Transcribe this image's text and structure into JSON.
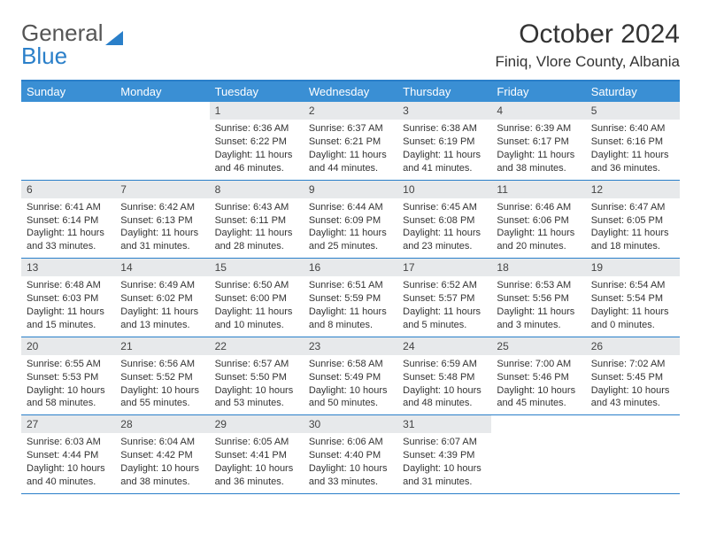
{
  "logo": {
    "part1": "General",
    "part2": "Blue"
  },
  "title": "October 2024",
  "location": "Finiq, Vlore County, Albania",
  "days_of_week": [
    "Sunday",
    "Monday",
    "Tuesday",
    "Wednesday",
    "Thursday",
    "Friday",
    "Saturday"
  ],
  "weeks": [
    [
      null,
      null,
      {
        "n": "1",
        "sr": "Sunrise: 6:36 AM",
        "ss": "Sunset: 6:22 PM",
        "d1": "Daylight: 11 hours",
        "d2": "and 46 minutes."
      },
      {
        "n": "2",
        "sr": "Sunrise: 6:37 AM",
        "ss": "Sunset: 6:21 PM",
        "d1": "Daylight: 11 hours",
        "d2": "and 44 minutes."
      },
      {
        "n": "3",
        "sr": "Sunrise: 6:38 AM",
        "ss": "Sunset: 6:19 PM",
        "d1": "Daylight: 11 hours",
        "d2": "and 41 minutes."
      },
      {
        "n": "4",
        "sr": "Sunrise: 6:39 AM",
        "ss": "Sunset: 6:17 PM",
        "d1": "Daylight: 11 hours",
        "d2": "and 38 minutes."
      },
      {
        "n": "5",
        "sr": "Sunrise: 6:40 AM",
        "ss": "Sunset: 6:16 PM",
        "d1": "Daylight: 11 hours",
        "d2": "and 36 minutes."
      }
    ],
    [
      {
        "n": "6",
        "sr": "Sunrise: 6:41 AM",
        "ss": "Sunset: 6:14 PM",
        "d1": "Daylight: 11 hours",
        "d2": "and 33 minutes."
      },
      {
        "n": "7",
        "sr": "Sunrise: 6:42 AM",
        "ss": "Sunset: 6:13 PM",
        "d1": "Daylight: 11 hours",
        "d2": "and 31 minutes."
      },
      {
        "n": "8",
        "sr": "Sunrise: 6:43 AM",
        "ss": "Sunset: 6:11 PM",
        "d1": "Daylight: 11 hours",
        "d2": "and 28 minutes."
      },
      {
        "n": "9",
        "sr": "Sunrise: 6:44 AM",
        "ss": "Sunset: 6:09 PM",
        "d1": "Daylight: 11 hours",
        "d2": "and 25 minutes."
      },
      {
        "n": "10",
        "sr": "Sunrise: 6:45 AM",
        "ss": "Sunset: 6:08 PM",
        "d1": "Daylight: 11 hours",
        "d2": "and 23 minutes."
      },
      {
        "n": "11",
        "sr": "Sunrise: 6:46 AM",
        "ss": "Sunset: 6:06 PM",
        "d1": "Daylight: 11 hours",
        "d2": "and 20 minutes."
      },
      {
        "n": "12",
        "sr": "Sunrise: 6:47 AM",
        "ss": "Sunset: 6:05 PM",
        "d1": "Daylight: 11 hours",
        "d2": "and 18 minutes."
      }
    ],
    [
      {
        "n": "13",
        "sr": "Sunrise: 6:48 AM",
        "ss": "Sunset: 6:03 PM",
        "d1": "Daylight: 11 hours",
        "d2": "and 15 minutes."
      },
      {
        "n": "14",
        "sr": "Sunrise: 6:49 AM",
        "ss": "Sunset: 6:02 PM",
        "d1": "Daylight: 11 hours",
        "d2": "and 13 minutes."
      },
      {
        "n": "15",
        "sr": "Sunrise: 6:50 AM",
        "ss": "Sunset: 6:00 PM",
        "d1": "Daylight: 11 hours",
        "d2": "and 10 minutes."
      },
      {
        "n": "16",
        "sr": "Sunrise: 6:51 AM",
        "ss": "Sunset: 5:59 PM",
        "d1": "Daylight: 11 hours",
        "d2": "and 8 minutes."
      },
      {
        "n": "17",
        "sr": "Sunrise: 6:52 AM",
        "ss": "Sunset: 5:57 PM",
        "d1": "Daylight: 11 hours",
        "d2": "and 5 minutes."
      },
      {
        "n": "18",
        "sr": "Sunrise: 6:53 AM",
        "ss": "Sunset: 5:56 PM",
        "d1": "Daylight: 11 hours",
        "d2": "and 3 minutes."
      },
      {
        "n": "19",
        "sr": "Sunrise: 6:54 AM",
        "ss": "Sunset: 5:54 PM",
        "d1": "Daylight: 11 hours",
        "d2": "and 0 minutes."
      }
    ],
    [
      {
        "n": "20",
        "sr": "Sunrise: 6:55 AM",
        "ss": "Sunset: 5:53 PM",
        "d1": "Daylight: 10 hours",
        "d2": "and 58 minutes."
      },
      {
        "n": "21",
        "sr": "Sunrise: 6:56 AM",
        "ss": "Sunset: 5:52 PM",
        "d1": "Daylight: 10 hours",
        "d2": "and 55 minutes."
      },
      {
        "n": "22",
        "sr": "Sunrise: 6:57 AM",
        "ss": "Sunset: 5:50 PM",
        "d1": "Daylight: 10 hours",
        "d2": "and 53 minutes."
      },
      {
        "n": "23",
        "sr": "Sunrise: 6:58 AM",
        "ss": "Sunset: 5:49 PM",
        "d1": "Daylight: 10 hours",
        "d2": "and 50 minutes."
      },
      {
        "n": "24",
        "sr": "Sunrise: 6:59 AM",
        "ss": "Sunset: 5:48 PM",
        "d1": "Daylight: 10 hours",
        "d2": "and 48 minutes."
      },
      {
        "n": "25",
        "sr": "Sunrise: 7:00 AM",
        "ss": "Sunset: 5:46 PM",
        "d1": "Daylight: 10 hours",
        "d2": "and 45 minutes."
      },
      {
        "n": "26",
        "sr": "Sunrise: 7:02 AM",
        "ss": "Sunset: 5:45 PM",
        "d1": "Daylight: 10 hours",
        "d2": "and 43 minutes."
      }
    ],
    [
      {
        "n": "27",
        "sr": "Sunrise: 6:03 AM",
        "ss": "Sunset: 4:44 PM",
        "d1": "Daylight: 10 hours",
        "d2": "and 40 minutes."
      },
      {
        "n": "28",
        "sr": "Sunrise: 6:04 AM",
        "ss": "Sunset: 4:42 PM",
        "d1": "Daylight: 10 hours",
        "d2": "and 38 minutes."
      },
      {
        "n": "29",
        "sr": "Sunrise: 6:05 AM",
        "ss": "Sunset: 4:41 PM",
        "d1": "Daylight: 10 hours",
        "d2": "and 36 minutes."
      },
      {
        "n": "30",
        "sr": "Sunrise: 6:06 AM",
        "ss": "Sunset: 4:40 PM",
        "d1": "Daylight: 10 hours",
        "d2": "and 33 minutes."
      },
      {
        "n": "31",
        "sr": "Sunrise: 6:07 AM",
        "ss": "Sunset: 4:39 PM",
        "d1": "Daylight: 10 hours",
        "d2": "and 31 minutes."
      },
      null,
      null
    ]
  ]
}
